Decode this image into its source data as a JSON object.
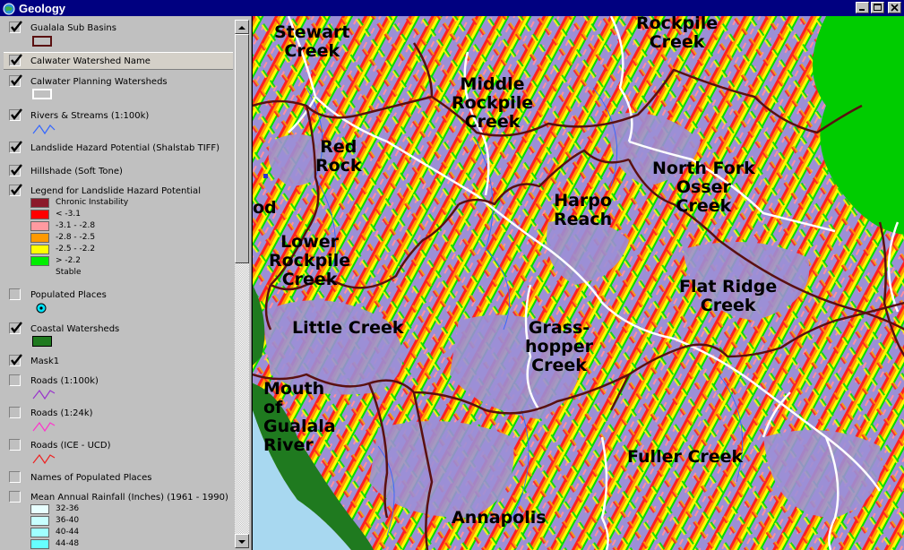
{
  "window": {
    "title": "Geology",
    "icon": "globe-icon",
    "buttons": [
      "minimize-icon",
      "maximize-icon",
      "close-icon"
    ]
  },
  "toc": {
    "layers": [
      {
        "id": "gualala-sub-basins",
        "name": "Gualala Sub Basins",
        "checked": true
      },
      {
        "id": "calwater-watershed-name",
        "name": "Calwater Watershed Name",
        "checked": true
      },
      {
        "id": "calwater-planning-watersheds",
        "name": "Calwater Planning Watersheds",
        "checked": true
      },
      {
        "id": "rivers-streams",
        "name": "Rivers & Streams (1:100k)",
        "checked": true
      },
      {
        "id": "landslide-hazard",
        "name": "Landslide Hazard Potential (Shalstab TIFF)",
        "checked": true
      },
      {
        "id": "hillshade",
        "name": "Hillshade (Soft Tone)",
        "checked": true
      },
      {
        "id": "legend-landslide",
        "name": "Legend for Landslide Hazard Potential",
        "checked": true
      },
      {
        "id": "populated-places",
        "name": "Populated Places",
        "checked": false
      },
      {
        "id": "coastal-watersheds",
        "name": "Coastal Watersheds",
        "checked": true
      },
      {
        "id": "mask1",
        "name": "Mask1",
        "checked": true
      },
      {
        "id": "roads-100k",
        "name": "Roads (1:100k)",
        "checked": false
      },
      {
        "id": "roads-24k",
        "name": "Roads (1:24k)",
        "checked": false
      },
      {
        "id": "roads-ice",
        "name": "Roads (ICE - UCD)",
        "checked": false
      },
      {
        "id": "names-populated-places",
        "name": "Names of Populated Places",
        "checked": false
      },
      {
        "id": "mean-annual-rainfall",
        "name": "Mean Annual Rainfall (Inches) (1961 - 1990)",
        "checked": false
      }
    ],
    "landslide_legend": [
      {
        "label": "Chronic Instability",
        "color": "#8b1a2b"
      },
      {
        "label": "< -3.1",
        "color": "#ff0000"
      },
      {
        "label": "-3.1 - -2.8",
        "color": "#ff9aa0"
      },
      {
        "label": "-2.8 - -2.5",
        "color": "#ff9900"
      },
      {
        "label": "-2.5 - -2.2",
        "color": "#ffff00"
      },
      {
        "label": "> -2.2",
        "color": "#00ee00"
      },
      {
        "label": "Stable",
        "color": ""
      }
    ],
    "rainfall_legend": [
      {
        "label": "32-36",
        "color": "#e8ffff"
      },
      {
        "label": "36-40",
        "color": "#c8ffff"
      },
      {
        "label": "40-44",
        "color": "#a0ffff"
      },
      {
        "label": "44-48",
        "color": "#66ffff"
      }
    ]
  },
  "map": {
    "labels": [
      {
        "id": "stewart-creek",
        "text": "Stewart\nCreek"
      },
      {
        "id": "rockpile-creek",
        "text": "Rockpile\nCreek"
      },
      {
        "id": "middle-rockpile-creek",
        "text": "Middle\nRockpile\nCreek"
      },
      {
        "id": "red-rock",
        "text": "Red\nRock"
      },
      {
        "id": "north-fork-osser-creek",
        "text": "North Fork\nOsser\nCreek"
      },
      {
        "id": "harpo-reach",
        "text": "Harpo\nReach"
      },
      {
        "id": "od",
        "text": "od"
      },
      {
        "id": "lower-rockpile-creek",
        "text": "Lower\nRockpile\nCreek"
      },
      {
        "id": "flat-ridge-creek",
        "text": "Flat Ridge\nCreek"
      },
      {
        "id": "little-creek",
        "text": "Little Creek"
      },
      {
        "id": "grasshopper-creek",
        "text": "Grass-\nhopper\nCreek"
      },
      {
        "id": "mouth-of-gualala-river",
        "text": "Mouth\nof\nGualala\nRiver"
      },
      {
        "id": "fuller-creek",
        "text": "Fuller Creek"
      },
      {
        "id": "annapolis",
        "text": "Annapolis"
      }
    ],
    "colors": {
      "terrain": "#9c8fd6",
      "coastal_watershed": "#1f7a1f",
      "ocean": "#a8d8f0",
      "bright_green": "#00cc00",
      "boundary": "#5a1010",
      "planning_boundary": "#ffffff"
    }
  }
}
